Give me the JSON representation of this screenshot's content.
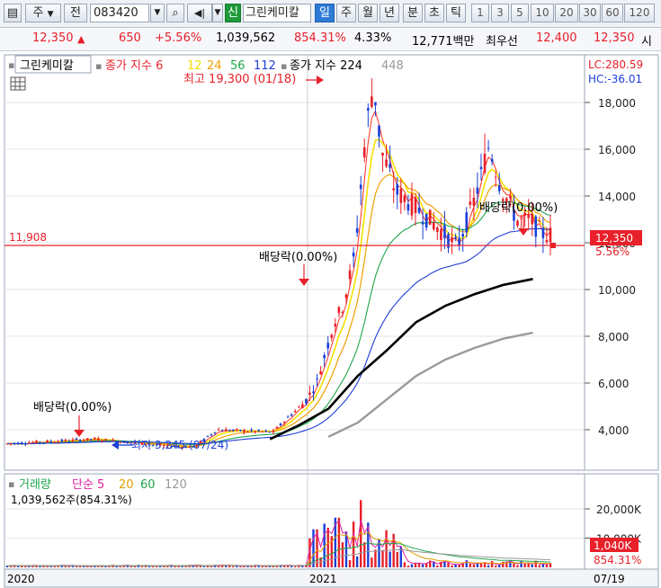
{
  "toolbar": {
    "market": "주",
    "period_code": "전",
    "stock_code": "083420",
    "new_badge": "신",
    "stock_name": "그린케미칼",
    "periods": [
      "일",
      "주",
      "월",
      "년",
      "분",
      "초",
      "틱"
    ],
    "active_period": "일",
    "intervals": [
      "1",
      "3",
      "5",
      "10",
      "20",
      "30",
      "60",
      "120"
    ]
  },
  "info": {
    "price": "12,350",
    "change_arrow": "▲",
    "change": "650",
    "change_pct": "+5.56%",
    "volume": "1,039,562",
    "volume_ratio": "854.31%",
    "turnover": "4.33%",
    "amount": "12,771백만",
    "priority_label": "최우선",
    "best_ask": "12,400",
    "best_bid": "12,350",
    "market_label": "시"
  },
  "price_panel": {
    "stock_label": "그린케미칼",
    "ma_label": "종가 지수 6",
    "ma_periods": [
      "12",
      "24",
      "56",
      "112"
    ],
    "ma_label2": "종가 지수 224",
    "ma_extra": "448",
    "lc": "LC:280.59",
    "hc": "HC:-36.01",
    "high_note": "최고 19,300 (01/18)",
    "low_note": "최저 3,245 (07/24)",
    "dividend_note": "배당락(0.00%)",
    "ref_line_value": "11,908",
    "current_price": "12,350",
    "current_pct": "5.56%",
    "y_ticks": [
      "4,000",
      "6,000",
      "8,000",
      "10,000",
      "12,000",
      "14,000",
      "16,000",
      "18,000"
    ]
  },
  "volume_panel": {
    "title": "거래량",
    "ma_label": "단순 5",
    "ma_periods": [
      "20",
      "60",
      "120"
    ],
    "volume_text": "1,039,562주(854.31%)",
    "current_volume": "1,040K",
    "current_pct": "854.31%",
    "y_ticks": [
      "10,000K",
      "20,000K"
    ]
  },
  "x_axis": {
    "labels": [
      "2020",
      "2021",
      "07/19"
    ]
  },
  "colors": {
    "up": "#e8202a",
    "down": "#1a3fd8",
    "ma6": "#ff3020",
    "ma12": "#f4e000",
    "ma24": "#f0a000",
    "ma56": "#1ea64a",
    "ma112": "#1e3cd6",
    "ma224": "#000000",
    "ma448": "#9a9a9a",
    "vol_ma5": "#e020a0",
    "vol_ma20": "#e0a000",
    "vol_ma60": "#1ea64a",
    "vol_ma120": "#999999"
  },
  "chart_data": {
    "type": "line",
    "title": "그린케미칼 (083420) 일봉",
    "x": [
      "2020-01",
      "2020-03",
      "2020-05",
      "2020-07",
      "2020-08",
      "2020-09",
      "2020-10",
      "2020-11",
      "2020-12",
      "2021-01",
      "2021-02",
      "2021-03",
      "2021-04",
      "2021-05",
      "2021-06",
      "2021-07"
    ],
    "series": [
      {
        "name": "종가",
        "values": [
          3500,
          3650,
          3700,
          3300,
          3900,
          3800,
          4800,
          5800,
          8800,
          16500,
          15500,
          14000,
          13000,
          14600,
          12900,
          12350
        ]
      },
      {
        "name": "224",
        "values": [
          null,
          null,
          null,
          null,
          null,
          null,
          3600,
          4200,
          4900,
          6300,
          7400,
          8600,
          9300,
          9800,
          10200,
          10450
        ]
      },
      {
        "name": "448",
        "values": [
          null,
          null,
          null,
          null,
          null,
          null,
          null,
          null,
          3700,
          4300,
          5300,
          6300,
          7000,
          7500,
          7900,
          8150
        ]
      }
    ],
    "high": {
      "value": 19300,
      "date": "01/18"
    },
    "low": {
      "value": 3245,
      "date": "07/24"
    },
    "ylim": [
      3000,
      19800
    ],
    "volume_ylim": [
      0,
      25000
    ],
    "volume_unit": "K"
  }
}
